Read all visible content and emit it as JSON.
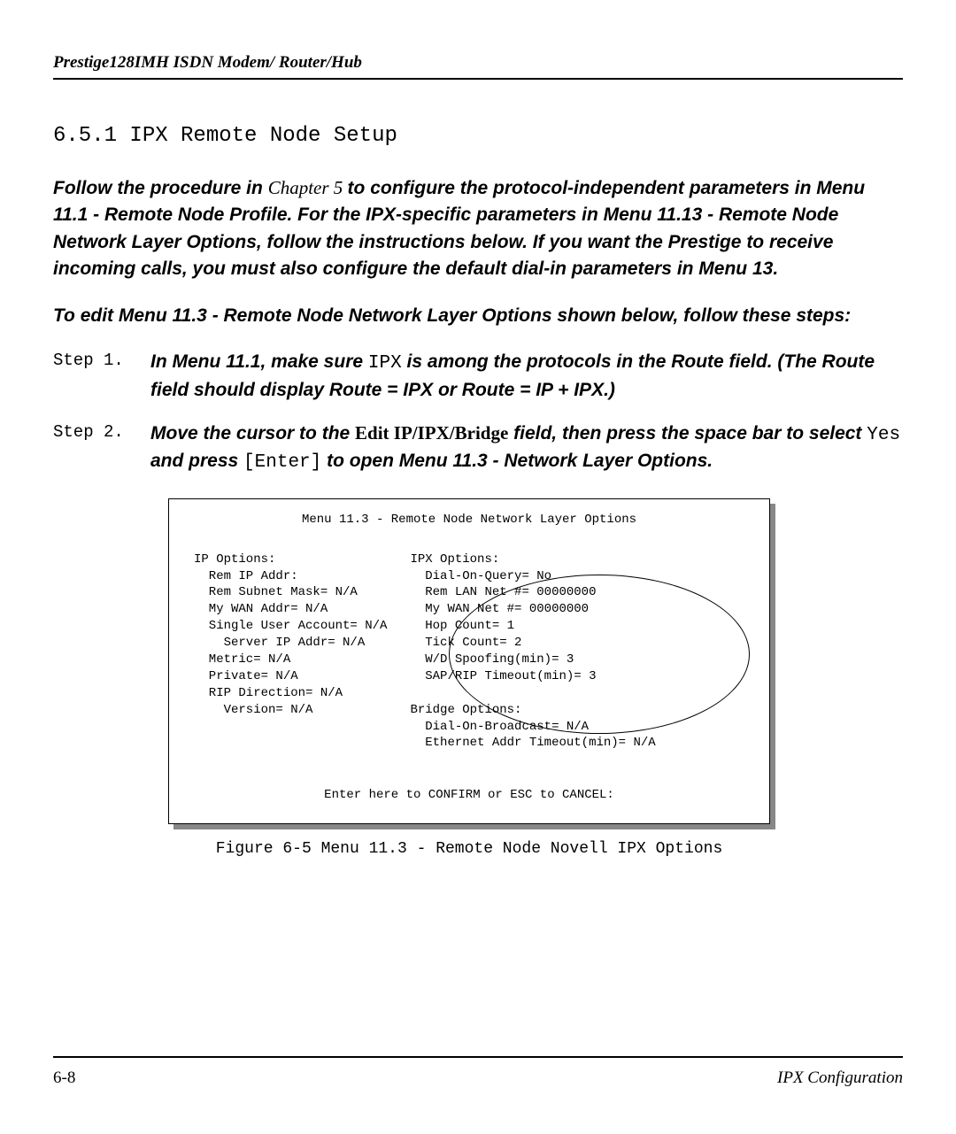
{
  "header": {
    "title": "Prestige128IMH ISDN Modem/ Router/Hub"
  },
  "section": {
    "number": "6.5.1",
    "title": "IPX Remote Node Setup"
  },
  "para1_prefix": "Follow the procedure in",
  "para1_chapter": "Chapter 5 ",
  "para1_mid1": " to configure the protocol-independent parameters in Menu 11.1 - Remote Node Profile. For the IPX-specific parameters in Menu 11.13 - Remote Node Network Layer Options, follow the instructions below. If you want the Prestige to receive incoming calls, you must also configure the default dial-in parameters in Menu 13.",
  "para2": "To edit Menu 11.3 - Remote Node Network Layer Options shown below, follow these steps:",
  "steps": [
    {
      "label": "Step 1.",
      "pre": "In Menu 11.1, make sure ",
      "mono": "IPX",
      "post": " is among the protocols in the Route field. (The Route field should display Route = IPX or Route = IP + IPX.)"
    },
    {
      "label": "Step 2.",
      "pre": "Move the cursor to the ",
      "bold": "Edit IP/IPX/Bridge",
      "mid": " field, then press the space bar to select ",
      "mono1": "Yes",
      "mid2": " and press ",
      "mono2": "[Enter]",
      "post": " to open Menu 11.3 - Network Layer Options."
    }
  ],
  "menu": {
    "title": "Menu 11.3 - Remote Node Network Layer Options",
    "left": "IP Options:\n  Rem IP Addr:\n  Rem Subnet Mask= N/A\n  My WAN Addr= N/A\n  Single User Account= N/A\n    Server IP Addr= N/A\n  Metric= N/A\n  Private= N/A\n  RIP Direction= N/A\n    Version= N/A",
    "right": "IPX Options:\n  Dial-On-Query= No\n  Rem LAN Net #= 00000000\n  My WAN Net #= 00000000\n  Hop Count= 1\n  Tick Count= 2\n  W/D Spoofing(min)= 3\n  SAP/RIP Timeout(min)= 3\n\nBridge Options:\n  Dial-On-Broadcast= N/A\n  Ethernet Addr Timeout(min)= N/A",
    "footer": "Enter here to CONFIRM or ESC to CANCEL:"
  },
  "figure_caption": "Figure 6-5 Menu 11.3 - Remote Node Novell IPX Options",
  "footer": {
    "page": "6-8",
    "section": "IPX Configuration"
  }
}
